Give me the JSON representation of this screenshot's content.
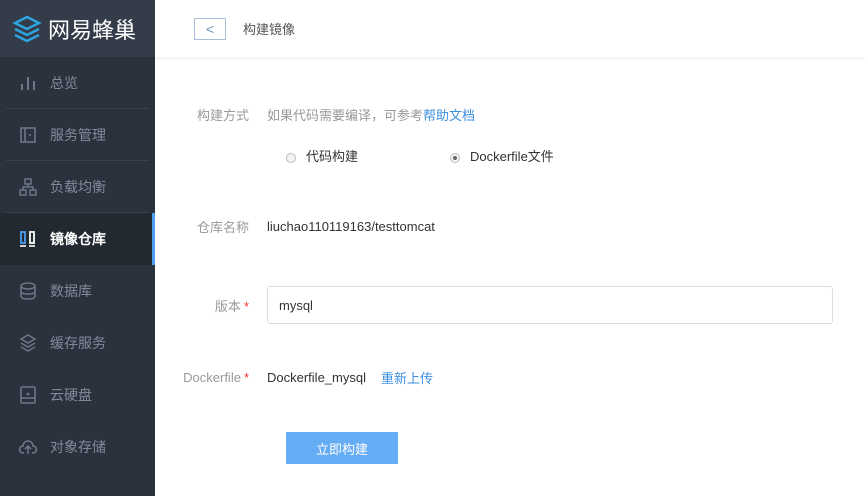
{
  "brand": "网易蜂巢",
  "nav": [
    {
      "label": "总览",
      "icon": "bar-chart-icon"
    },
    {
      "label": "服务管理",
      "icon": "door-icon"
    },
    {
      "label": "负载均衡",
      "icon": "network-icon"
    },
    {
      "label": "镜像仓库",
      "icon": "image-repo-icon",
      "active": true
    },
    {
      "label": "数据库",
      "icon": "database-icon"
    },
    {
      "label": "缓存服务",
      "icon": "layers-icon"
    },
    {
      "label": "云硬盘",
      "icon": "disk-icon"
    },
    {
      "label": "对象存储",
      "icon": "cloud-upload-icon"
    }
  ],
  "header": {
    "back": "<",
    "title": "构建镜像"
  },
  "form": {
    "method_label": "构建方式",
    "method_hint": "如果代码需要编译，可参考",
    "method_help_link": "帮助文档",
    "options": [
      "代码构建",
      "Dockerfile文件"
    ],
    "selected_option": "Dockerfile文件",
    "repo_label": "仓库名称",
    "repo_value": "liuchao110119163/testtomcat",
    "version_label": "版本",
    "version_value": "mysql",
    "dockerfile_label": "Dockerfile",
    "dockerfile_value": "Dockerfile_mysql",
    "reupload": "重新上传",
    "required_mark": "*",
    "submit": "立即构建"
  }
}
